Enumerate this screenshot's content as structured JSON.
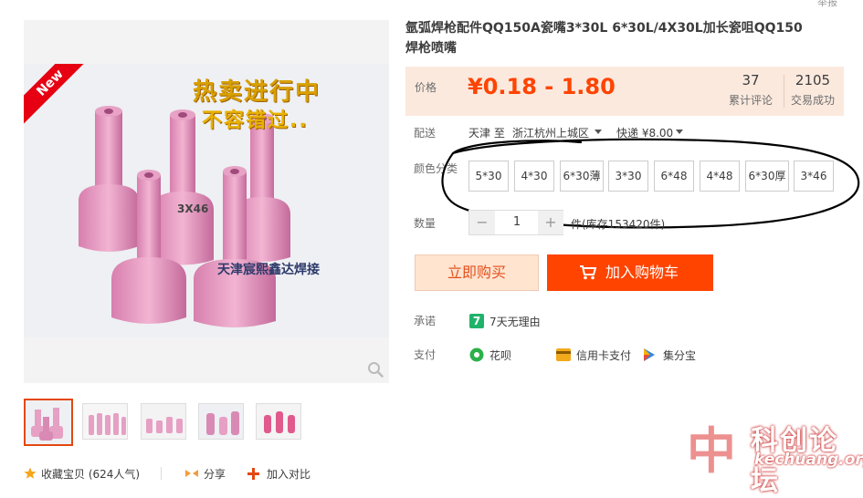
{
  "report_label": "举报",
  "photo": {
    "badge": "New",
    "banner_line1": "热卖进行中",
    "banner_line2": "不容错过..",
    "shop_stamp": "天津宸熙鑫达焊接",
    "product_mark": "3X46"
  },
  "title": "氩弧焊枪配件QQ150A瓷嘴3*30L 6*30L/4X30L加长瓷咀QQ150焊枪喷嘴",
  "price": {
    "label": "价格",
    "value": "¥0.18 - 1.80",
    "reviews_count": "37",
    "reviews_label": "累计评论",
    "sold_count": "2105",
    "sold_label": "交易成功"
  },
  "shipping": {
    "label": "配送",
    "origin": "天津 至",
    "destination": "浙江杭州上城区",
    "method": "快递 ¥8.00"
  },
  "color": {
    "label": "颜色分类",
    "options": [
      "5*30",
      "4*30",
      "6*30薄",
      "3*30",
      "6*48",
      "4*48",
      "6*30厚",
      "3*46"
    ]
  },
  "quantity": {
    "label": "数量",
    "minus": "−",
    "value": "1",
    "plus": "+",
    "stock": "件(库存153420件)"
  },
  "buttons": {
    "buy_now": "立即购买",
    "add_to_cart": "加入购物车"
  },
  "promise": {
    "label": "承诺",
    "icon_text": "7",
    "text": "7天无理由"
  },
  "payment": {
    "label": "支付",
    "methods": [
      "花呗",
      "信用卡支付",
      "集分宝"
    ]
  },
  "bottom": {
    "favorite": "收藏宝贝 (624人气)",
    "share": "分享",
    "compare": "加入对比"
  },
  "watermark": {
    "logo_char": "中",
    "name": "科创论坛",
    "url": "kechuang.org"
  },
  "colors": {
    "accent": "#ff4400",
    "price": "#ff4400",
    "price_bg": "#fbe9de"
  }
}
